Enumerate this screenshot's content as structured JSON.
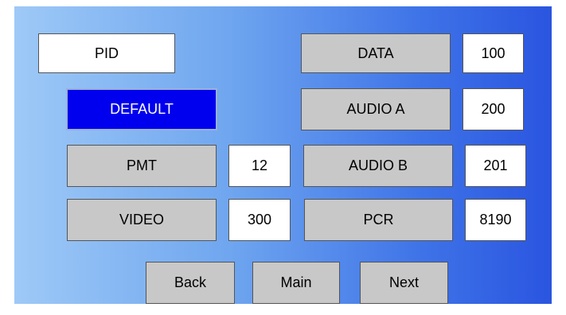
{
  "title": "PID",
  "default_button": "DEFAULT",
  "fields": {
    "data": {
      "label": "DATA",
      "value": "100"
    },
    "audio_a": {
      "label": "AUDIO A",
      "value": "200"
    },
    "pmt": {
      "label": "PMT",
      "value": "12"
    },
    "audio_b": {
      "label": "AUDIO B",
      "value": "201"
    },
    "video": {
      "label": "VIDEO",
      "value": "300"
    },
    "pcr": {
      "label": "PCR",
      "value": "8190"
    }
  },
  "nav": {
    "back": "Back",
    "main": "Main",
    "next": "Next"
  },
  "colors": {
    "gradient_left": "#9ec9f7",
    "gradient_right": "#2a55e0",
    "button_gray": "#c8c8c8",
    "default_blue": "#0000ee"
  }
}
